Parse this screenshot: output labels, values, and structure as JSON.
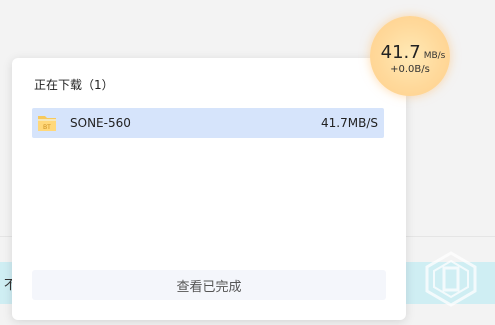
{
  "background": {
    "strip_text": "不"
  },
  "speed_indicator": {
    "download_speed_value": "41.7",
    "download_speed_unit": "MB/s",
    "upload_speed": "+0.0B/s"
  },
  "panel": {
    "title": "正在下载（1）",
    "downloads": [
      {
        "name": "SONE-560",
        "speed": "41.7MB/S",
        "icon": "bt-file-icon",
        "icon_label": "BT"
      }
    ],
    "footer_button": "查看已完成"
  },
  "colors": {
    "row_highlight": "#d6e4fb",
    "bubble": "#ffd99b",
    "strip": "#cfeef3"
  }
}
